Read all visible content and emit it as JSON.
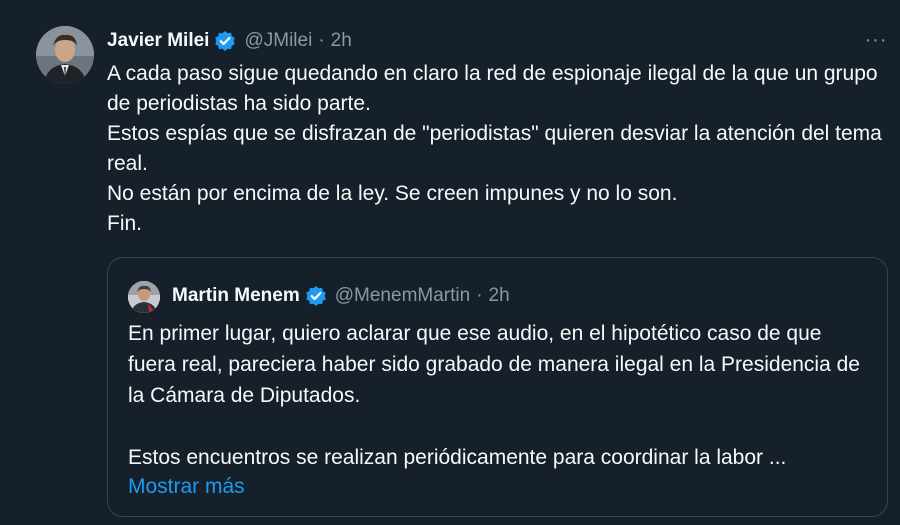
{
  "tweet": {
    "author_name": "Javier Milei",
    "handle": "@JMilei",
    "separator": "·",
    "time": "2h",
    "more_label": "···",
    "lines": [
      "A cada paso sigue quedando en claro la red de espionaje ilegal de la que un grupo de periodistas ha sido parte.",
      "Estos espías que se disfrazan de \"periodistas\" quieren desviar la atención del tema real.",
      "No están por encima de la ley. Se creen impunes y no lo son.",
      "Fin."
    ]
  },
  "quote": {
    "author_name": "Martin Menem",
    "handle": "@MenemMartin",
    "separator": "·",
    "time": "2h",
    "paragraph_1": "En primer lugar, quiero aclarar que ese audio, en el hipotético caso de que fuera real, pareciera haber sido grabado de manera ilegal en la Presidencia de la Cámara de Diputados.",
    "paragraph_2": "Estos encuentros se realizan periódicamente para coordinar la labor ...",
    "show_more": "Mostrar más"
  },
  "colors": {
    "background": "#15202b",
    "text": "#f7f9f9",
    "secondary": "#8b98a5",
    "accent": "#1d9bf0",
    "border": "#38444d"
  },
  "icons": {
    "verified": "verified-badge-icon",
    "more": "more-icon"
  }
}
